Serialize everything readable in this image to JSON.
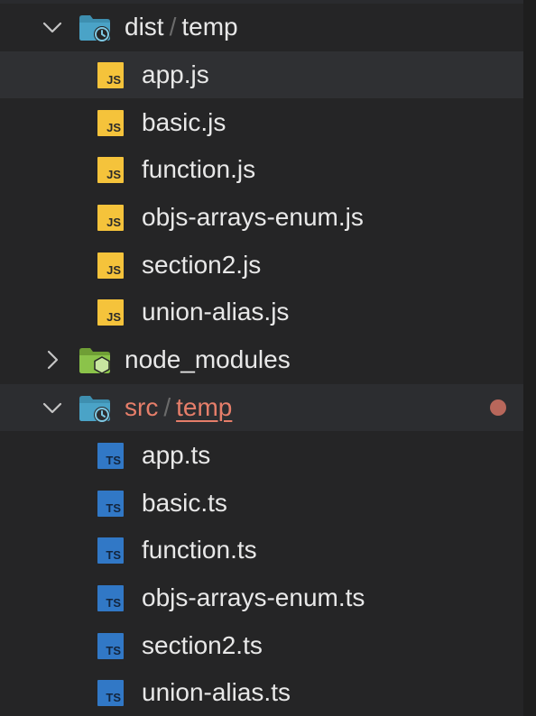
{
  "explorer": {
    "folders": [
      {
        "name_part1": "dist",
        "separator": "/",
        "name_part2": "temp",
        "expanded": true,
        "modified": false,
        "files": [
          {
            "label": "app.js",
            "icon_text": "JS",
            "type": "js"
          },
          {
            "label": "basic.js",
            "icon_text": "JS",
            "type": "js"
          },
          {
            "label": "function.js",
            "icon_text": "JS",
            "type": "js"
          },
          {
            "label": "objs-arrays-enum.js",
            "icon_text": "JS",
            "type": "js"
          },
          {
            "label": "section2.js",
            "icon_text": "JS",
            "type": "js"
          },
          {
            "label": "union-alias.js",
            "icon_text": "JS",
            "type": "js"
          }
        ]
      },
      {
        "name": "node_modules",
        "expanded": false
      },
      {
        "name_part1": "src",
        "separator": "/",
        "name_part2": "temp",
        "expanded": true,
        "modified": true,
        "files": [
          {
            "label": "app.ts",
            "icon_text": "TS",
            "type": "ts"
          },
          {
            "label": "basic.ts",
            "icon_text": "TS",
            "type": "ts"
          },
          {
            "label": "function.ts",
            "icon_text": "TS",
            "type": "ts"
          },
          {
            "label": "objs-arrays-enum.ts",
            "icon_text": "TS",
            "type": "ts"
          },
          {
            "label": "section2.ts",
            "icon_text": "TS",
            "type": "ts"
          },
          {
            "label": "union-alias.ts",
            "icon_text": "TS",
            "type": "ts"
          }
        ]
      }
    ],
    "colors": {
      "background": "#252526",
      "js_icon": "#f5c33b",
      "ts_icon": "#3178c6",
      "modified_text": "#e67e6a",
      "modified_dot": "#b8675b",
      "folder_icon": "#4aa3c7",
      "node_modules_icon": "#8bc34a"
    },
    "icons": {
      "expanded_chevron": "chevron-down-icon",
      "collapsed_chevron": "chevron-right-icon",
      "dist_folder": "folder-clock-icon",
      "node_folder": "nodejs-folder-icon",
      "src_folder": "folder-clock-icon"
    }
  }
}
